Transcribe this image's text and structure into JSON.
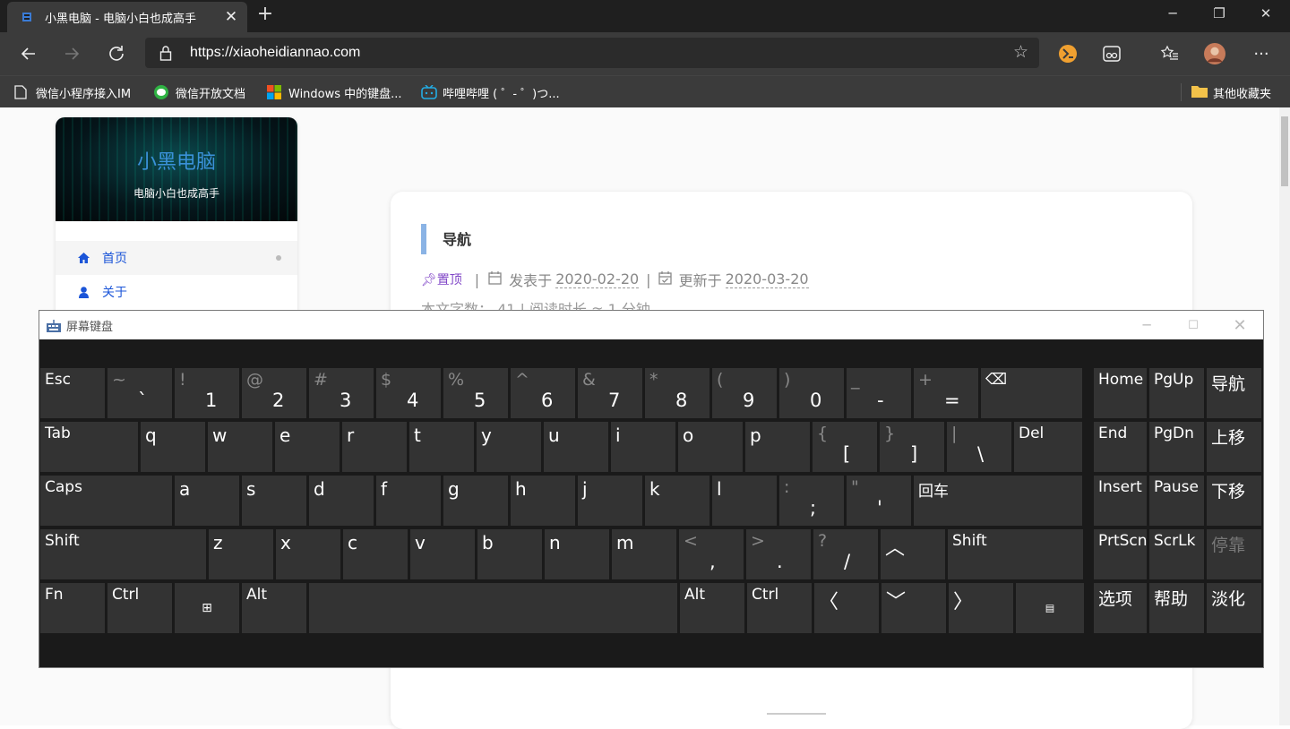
{
  "browser": {
    "tab_title": "小黑电脑 - 电脑小白也成高手",
    "tab_close": "✕",
    "new_tab": "+",
    "url_scheme": "https://",
    "url_host": "xiaoheidiannao.com",
    "window": {
      "minimize": "─",
      "maximize": "❐",
      "close": "✕"
    },
    "bookmarks": [
      {
        "label": "微信小程序接入IM",
        "icon": "page-icon"
      },
      {
        "label": "微信开放文档",
        "icon": "wechat-icon"
      },
      {
        "label": "Windows 中的键盘...",
        "icon": "windows-icon"
      },
      {
        "label": "哔哩哔哩 ( ゜- ゜)つ...",
        "icon": "bilibili-icon"
      }
    ],
    "other_bookmarks": "其他收藏夹",
    "more": "···"
  },
  "site": {
    "title": "小黑电脑",
    "subtitle": "电脑小白也成高手",
    "menu": [
      {
        "label": "首页",
        "icon": "home-icon"
      },
      {
        "label": "关于",
        "icon": "user-icon"
      }
    ]
  },
  "post": {
    "title": "导航",
    "pinned": "置顶",
    "sep": "|",
    "published_label": "发表于",
    "published_date": "2020-02-20",
    "updated_label": "更新于",
    "updated_date": "2020-03-20",
    "meta2": "本文字数： 41 | 阅读时长 ≈ 1 分钟"
  },
  "osk": {
    "title": "屏幕键盘",
    "rows": [
      [
        {
          "l": "Esc"
        },
        {
          "t": "~",
          "b": "`"
        },
        {
          "t": "!",
          "b": "1"
        },
        {
          "t": "@",
          "b": "2"
        },
        {
          "t": "#",
          "b": "3"
        },
        {
          "t": "$",
          "b": "4"
        },
        {
          "t": "%",
          "b": "5"
        },
        {
          "t": "^",
          "b": "6"
        },
        {
          "t": "&",
          "b": "7"
        },
        {
          "t": "*",
          "b": "8"
        },
        {
          "t": "(",
          "b": "9"
        },
        {
          "t": ")",
          "b": "0"
        },
        {
          "t": "_",
          "b": "-"
        },
        {
          "t": "+",
          "b": "="
        },
        {
          "l": "⌫"
        }
      ],
      [
        {
          "l": "Tab"
        },
        {
          "l": "q"
        },
        {
          "l": "w"
        },
        {
          "l": "e"
        },
        {
          "l": "r"
        },
        {
          "l": "t"
        },
        {
          "l": "y"
        },
        {
          "l": "u"
        },
        {
          "l": "i"
        },
        {
          "l": "o"
        },
        {
          "l": "p"
        },
        {
          "t": "{",
          "b": "["
        },
        {
          "t": "}",
          "b": "]"
        },
        {
          "t": "|",
          "b": "\\"
        },
        {
          "l": "Del"
        }
      ],
      [
        {
          "l": "Caps"
        },
        {
          "l": "a"
        },
        {
          "l": "s"
        },
        {
          "l": "d"
        },
        {
          "l": "f"
        },
        {
          "l": "g"
        },
        {
          "l": "h"
        },
        {
          "l": "j"
        },
        {
          "l": "k"
        },
        {
          "l": "l"
        },
        {
          "t": ":",
          "b": ";"
        },
        {
          "t": "\"",
          "b": "'"
        },
        {
          "l": "回车"
        }
      ],
      [
        {
          "l": "Shift"
        },
        {
          "l": "z"
        },
        {
          "l": "x"
        },
        {
          "l": "c"
        },
        {
          "l": "v"
        },
        {
          "l": "b"
        },
        {
          "l": "n"
        },
        {
          "l": "m"
        },
        {
          "t": "<",
          "b": ","
        },
        {
          "t": ">",
          "b": "."
        },
        {
          "t": "?",
          "b": "/"
        },
        {
          "l": "︿"
        },
        {
          "l": "Shift"
        }
      ],
      [
        {
          "l": "Fn"
        },
        {
          "l": "Ctrl"
        },
        {
          "l": "⊞"
        },
        {
          "l": "Alt"
        },
        {
          "l": ""
        },
        {
          "l": "Alt"
        },
        {
          "l": "Ctrl"
        },
        {
          "l": "〈"
        },
        {
          "l": "﹀"
        },
        {
          "l": "〉"
        },
        {
          "l": "▤"
        }
      ]
    ],
    "nav": [
      [
        "Home",
        "PgUp",
        "导航"
      ],
      [
        "End",
        "PgDn",
        "上移"
      ],
      [
        "Insert",
        "Pause",
        "下移"
      ],
      [
        "PrtScn",
        "ScrLk",
        "停靠"
      ],
      [
        "选项",
        "帮助",
        "淡化"
      ]
    ]
  }
}
